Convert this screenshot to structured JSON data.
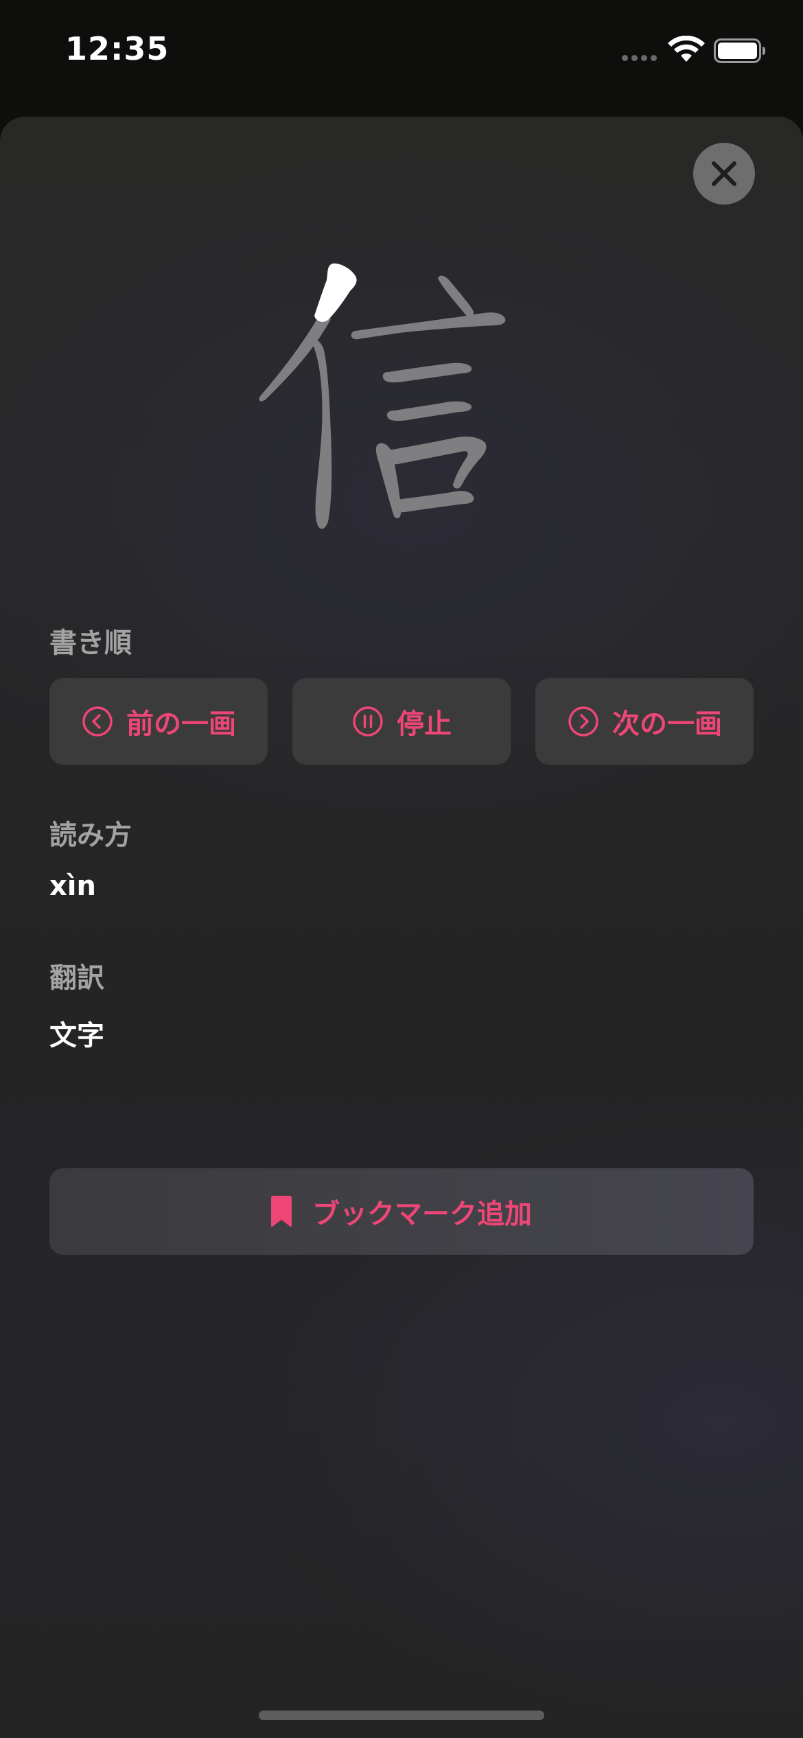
{
  "status_bar": {
    "time": "12:35"
  },
  "character": {
    "glyph": "信",
    "highlighted_stroke": 1,
    "highlight_color": "#ffffff",
    "stroke_color": "#7f7f81"
  },
  "stroke_order": {
    "label": "書き順",
    "prev_label": "前の一画",
    "pause_label": "停止",
    "next_label": "次の一画"
  },
  "reading": {
    "label": "読み方",
    "value": "xìn"
  },
  "translation": {
    "label": "翻訳",
    "value": "文字"
  },
  "bookmark": {
    "label": "ブックマーク追加"
  },
  "colors": {
    "accent": "#ee4676",
    "button_bg": "#3b3b3c",
    "close_bg": "#6e6e6e"
  },
  "icons": {
    "close": "close-icon",
    "prev": "chevron-left-circle-icon",
    "pause": "pause-circle-icon",
    "next": "chevron-right-circle-icon",
    "bookmark": "bookmark-icon"
  }
}
